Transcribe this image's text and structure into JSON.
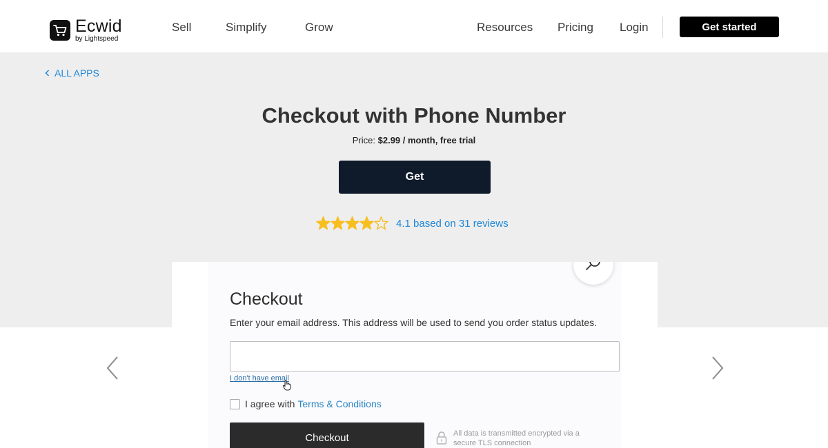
{
  "header": {
    "logo": {
      "name": "Ecwid",
      "sub": "by Lightspeed"
    },
    "nav_left": [
      "Sell",
      "Simplify",
      "Grow"
    ],
    "nav_right": [
      "Resources",
      "Pricing",
      "Login"
    ],
    "cta": "Get started"
  },
  "hero": {
    "back_link": "ALL APPS",
    "title": "Checkout with Phone Number",
    "price_label": "Price:",
    "price_value": "$2.99 / month, free trial",
    "get_button": "Get",
    "rating": {
      "value": 4.1,
      "stars_max": 5,
      "text": "4.1 based on 31 reviews"
    }
  },
  "screenshot": {
    "title": "Checkout",
    "description": "Enter your email address. This address will be used to send you order status updates.",
    "email_input": {
      "value": "",
      "placeholder": ""
    },
    "no_email_link": "I don't have email",
    "agree_prefix": "I agree with",
    "terms_link": "Terms & Conditions",
    "checkout_button": "Checkout",
    "secure_note": "All data is transmitted encrypted via a secure TLS connection"
  },
  "colors": {
    "accent_link": "#1e86d8",
    "star": "#f7be1f",
    "get_button": "#0f1b2b",
    "hero_bg": "#eeeeee"
  },
  "icons": [
    "cart-logo-icon",
    "chevron-left-icon",
    "star-icon",
    "search-zoom-icon",
    "lock-icon",
    "hand-cursor-icon",
    "arrow-left-icon",
    "arrow-right-icon"
  ]
}
